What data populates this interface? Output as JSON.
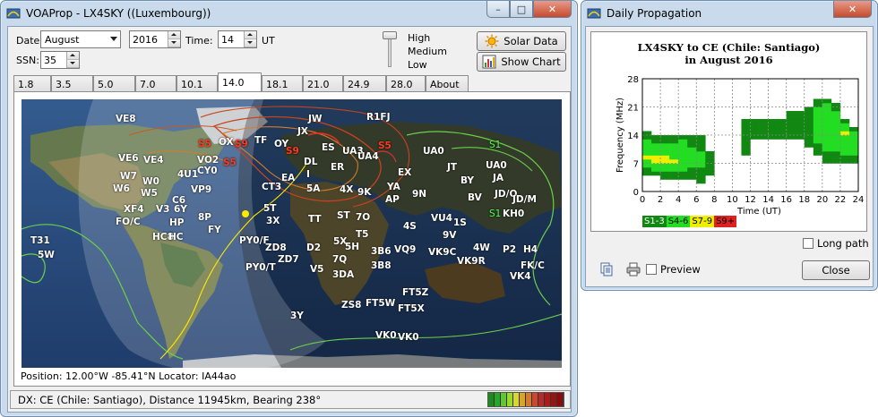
{
  "main_window": {
    "title": "VOAProp - LX4SKY ((Luxembourg))",
    "min_label": "–",
    "max_label": "□",
    "close_label": "✕",
    "date_label": "Date:",
    "month": "August",
    "year": "2016",
    "time_label": "Time:",
    "time": "14",
    "time_unit": "UT",
    "ssn_label": "SSN:",
    "ssn": "35",
    "level_high": "High",
    "level_medium": "Medium",
    "level_low": "Low",
    "solar_data_button": "Solar Data",
    "show_chart_button": "Show Chart",
    "tabs": [
      "1.8",
      "3.5",
      "5.0",
      "7.0",
      "10.1",
      "14.0",
      "18.1",
      "21.0",
      "24.9",
      "28.0",
      "About"
    ],
    "active_tab": "14.0",
    "position_text": "Position: 12.00°W -85.41°N  Locator: IA44ao",
    "status_text": "DX: CE (Chile: Santiago), Distance 11945km, Bearing 238°",
    "meter_colors": [
      "#1d8a1d",
      "#2aa52a",
      "#5cc92c",
      "#9ad82c",
      "#d8d82c",
      "#d8a52c",
      "#d8782c",
      "#c84a2c",
      "#b82a2a",
      "#a81c1c",
      "#981414",
      "#880c0c"
    ],
    "map_labels": [
      {
        "t": "VE8",
        "c": "white"
      },
      {
        "t": "JW",
        "c": "white"
      },
      {
        "t": "R1FJ",
        "c": "white"
      },
      {
        "t": "S5",
        "c": "red"
      },
      {
        "t": "OX",
        "c": "white"
      },
      {
        "t": "S9",
        "c": "red"
      },
      {
        "t": "TF",
        "c": "white"
      },
      {
        "t": "OY",
        "c": "white"
      },
      {
        "t": "JX",
        "c": "white"
      },
      {
        "t": "ES",
        "c": "white"
      },
      {
        "t": "UA3",
        "c": "white"
      },
      {
        "t": "S5",
        "c": "red"
      },
      {
        "t": "UA4",
        "c": "white"
      },
      {
        "t": "UA0",
        "c": "white"
      },
      {
        "t": "S1",
        "c": "green"
      },
      {
        "t": "VE6",
        "c": "white"
      },
      {
        "t": "VE4",
        "c": "white"
      },
      {
        "t": "VO2",
        "c": "white"
      },
      {
        "t": "S5",
        "c": "red"
      },
      {
        "t": "CY0",
        "c": "white"
      },
      {
        "t": "S9",
        "c": "red"
      },
      {
        "t": "DL",
        "c": "white"
      },
      {
        "t": "ER",
        "c": "white"
      },
      {
        "t": "JT",
        "c": "white"
      },
      {
        "t": "UA0",
        "c": "white"
      },
      {
        "t": "W7",
        "c": "white"
      },
      {
        "t": "4U1",
        "c": "white"
      },
      {
        "t": "EA",
        "c": "white"
      },
      {
        "t": "I",
        "c": "white"
      },
      {
        "t": "EX",
        "c": "white"
      },
      {
        "t": "BY",
        "c": "white"
      },
      {
        "t": "JA",
        "c": "white"
      },
      {
        "t": "W0",
        "c": "white"
      },
      {
        "t": "W6",
        "c": "white"
      },
      {
        "t": "W5",
        "c": "white"
      },
      {
        "t": "VP9",
        "c": "white"
      },
      {
        "t": "CT3",
        "c": "white"
      },
      {
        "t": "5A",
        "c": "white"
      },
      {
        "t": "4X",
        "c": "white"
      },
      {
        "t": "9K",
        "c": "white"
      },
      {
        "t": "YA",
        "c": "white"
      },
      {
        "t": "9N",
        "c": "white"
      },
      {
        "t": "BV",
        "c": "white"
      },
      {
        "t": "JD/O",
        "c": "white"
      },
      {
        "t": "JD/M",
        "c": "white"
      },
      {
        "t": "C6",
        "c": "white"
      },
      {
        "t": "XF4",
        "c": "white"
      },
      {
        "t": "V3",
        "c": "white"
      },
      {
        "t": "6Y",
        "c": "white"
      },
      {
        "t": "8P",
        "c": "white"
      },
      {
        "t": "5T",
        "c": "white"
      },
      {
        "t": "AP",
        "c": "white"
      },
      {
        "t": "KH0",
        "c": "white"
      },
      {
        "t": "FO/C",
        "c": "white"
      },
      {
        "t": "HP",
        "c": "white"
      },
      {
        "t": "3X",
        "c": "white"
      },
      {
        "t": "TT",
        "c": "white"
      },
      {
        "t": "ST",
        "c": "white"
      },
      {
        "t": "7O",
        "c": "white"
      },
      {
        "t": "VU4",
        "c": "white"
      },
      {
        "t": "4S",
        "c": "white"
      },
      {
        "t": "1S",
        "c": "white"
      },
      {
        "t": "S1",
        "c": "green"
      },
      {
        "t": "FY",
        "c": "white"
      },
      {
        "t": "T5",
        "c": "white"
      },
      {
        "t": "9V",
        "c": "white"
      },
      {
        "t": "T31",
        "c": "white"
      },
      {
        "t": "HC8",
        "c": "white"
      },
      {
        "t": "HC",
        "c": "white"
      },
      {
        "t": "PY0/F",
        "c": "white"
      },
      {
        "t": "ZD8",
        "c": "white"
      },
      {
        "t": "D2",
        "c": "white"
      },
      {
        "t": "5X",
        "c": "white"
      },
      {
        "t": "5H",
        "c": "white"
      },
      {
        "t": "3B6",
        "c": "white"
      },
      {
        "t": "VQ9",
        "c": "white"
      },
      {
        "t": "4W",
        "c": "white"
      },
      {
        "t": "P2",
        "c": "white"
      },
      {
        "t": "H4",
        "c": "white"
      },
      {
        "t": "5W",
        "c": "white"
      },
      {
        "t": "ZD7",
        "c": "white"
      },
      {
        "t": "7Q",
        "c": "white"
      },
      {
        "t": "VK9C",
        "c": "white"
      },
      {
        "t": "VK9R",
        "c": "white"
      },
      {
        "t": "FK/C",
        "c": "white"
      },
      {
        "t": "PY0/T",
        "c": "white"
      },
      {
        "t": "V5",
        "c": "white"
      },
      {
        "t": "3DA",
        "c": "white"
      },
      {
        "t": "3B8",
        "c": "white"
      },
      {
        "t": "VK4",
        "c": "white"
      },
      {
        "t": "FT5Z",
        "c": "white"
      },
      {
        "t": "ZS8",
        "c": "white"
      },
      {
        "t": "FT5W",
        "c": "white"
      },
      {
        "t": "FT5X",
        "c": "white"
      },
      {
        "t": "3Y",
        "c": "white"
      },
      {
        "t": "VK0",
        "c": "white"
      },
      {
        "t": "VK0",
        "c": "white"
      }
    ]
  },
  "prop_window": {
    "title": "Daily Propagation",
    "close_x_label": "✕",
    "long_path_label": "Long path",
    "preview_label": "Preview",
    "close_button": "Close"
  },
  "chart_data": {
    "type": "heatmap",
    "title_line1": "LX4SKY to CE (Chile: Santiago)",
    "title_line2": "in August 2016",
    "ylabel": "Frequency (MHz)",
    "xlabel": "Time (UT)",
    "x_ticks": [
      0,
      2,
      4,
      6,
      8,
      10,
      12,
      14,
      16,
      18,
      20,
      22,
      24
    ],
    "y_ticks": [
      0,
      7,
      14,
      21,
      28
    ],
    "xlim": [
      0,
      24
    ],
    "ylim": [
      0,
      28
    ],
    "legend": [
      {
        "label": "S1-3",
        "color": "#118811"
      },
      {
        "label": "S4-6",
        "color": "#22dd22"
      },
      {
        "label": "S7-9",
        "color": "#eeee00"
      },
      {
        "label": "S9+",
        "color": "#dd2222"
      }
    ],
    "cells_note_levels": "level 1=S1-3, 2=S4-6, 3=S7-9",
    "cells": [
      {
        "hour": 0,
        "fmin": 4,
        "fmax": 15,
        "level": [
          1,
          1,
          2,
          2,
          3,
          2,
          2,
          2,
          2,
          1,
          1
        ]
      },
      {
        "hour": 1,
        "fmin": 4,
        "fmax": 14,
        "level": [
          1,
          2,
          2,
          3,
          3,
          2,
          2,
          2,
          1,
          1
        ]
      },
      {
        "hour": 2,
        "fmin": 3,
        "fmax": 14,
        "level": [
          1,
          1,
          2,
          2,
          3,
          3,
          2,
          2,
          2,
          1,
          1
        ]
      },
      {
        "hour": 3,
        "fmin": 3,
        "fmax": 14,
        "level": [
          1,
          1,
          2,
          2,
          3,
          2,
          2,
          2,
          2,
          1,
          1
        ]
      },
      {
        "hour": 4,
        "fmin": 3,
        "fmax": 14,
        "level": [
          1,
          1,
          2,
          2,
          2,
          2,
          2,
          2,
          2,
          2,
          1
        ]
      },
      {
        "hour": 5,
        "fmin": 3,
        "fmax": 14,
        "level": [
          1,
          1,
          1,
          2,
          2,
          2,
          2,
          2,
          1,
          1,
          1
        ]
      },
      {
        "hour": 6,
        "fmin": 2,
        "fmax": 14,
        "level": [
          1,
          1,
          1,
          1,
          2,
          2,
          2,
          2,
          1,
          1,
          1,
          1
        ]
      },
      {
        "hour": 7,
        "fmin": 4,
        "fmax": 10,
        "level": [
          1,
          1,
          1,
          1,
          1,
          1
        ]
      },
      {
        "hour": 11,
        "fmin": 9,
        "fmax": 18,
        "level": [
          1,
          1,
          1,
          1,
          1,
          1,
          1,
          1,
          1
        ]
      },
      {
        "hour": 12,
        "fmin": 13,
        "fmax": 18,
        "level": [
          1,
          1,
          1,
          1,
          1
        ]
      },
      {
        "hour": 13,
        "fmin": 13,
        "fmax": 18,
        "level": [
          1,
          1,
          1,
          1,
          1
        ]
      },
      {
        "hour": 14,
        "fmin": 13,
        "fmax": 18,
        "level": [
          1,
          1,
          1,
          1,
          1
        ]
      },
      {
        "hour": 15,
        "fmin": 13,
        "fmax": 18,
        "level": [
          1,
          1,
          1,
          1,
          1
        ]
      },
      {
        "hour": 16,
        "fmin": 13,
        "fmax": 20,
        "level": [
          1,
          1,
          1,
          1,
          1,
          1,
          1
        ]
      },
      {
        "hour": 17,
        "fmin": 13,
        "fmax": 20,
        "level": [
          1,
          1,
          1,
          1,
          1,
          1,
          1
        ]
      },
      {
        "hour": 18,
        "fmin": 11,
        "fmax": 21,
        "level": [
          1,
          1,
          1,
          1,
          1,
          1,
          1,
          1,
          1,
          1
        ]
      },
      {
        "hour": 19,
        "fmin": 9,
        "fmax": 23,
        "level": [
          1,
          1,
          1,
          2,
          2,
          2,
          2,
          2,
          2,
          2,
          2,
          2,
          1,
          1
        ]
      },
      {
        "hour": 20,
        "fmin": 7,
        "fmax": 23,
        "level": [
          1,
          1,
          1,
          2,
          2,
          2,
          2,
          2,
          2,
          2,
          2,
          2,
          2,
          2,
          2,
          1
        ]
      },
      {
        "hour": 21,
        "fmin": 7,
        "fmax": 22,
        "level": [
          1,
          1,
          1,
          2,
          2,
          2,
          2,
          2,
          2,
          2,
          2,
          2,
          2,
          1,
          1
        ]
      },
      {
        "hour": 22,
        "fmin": 7,
        "fmax": 18,
        "level": [
          1,
          1,
          2,
          2,
          2,
          2,
          2,
          3,
          2,
          2,
          1
        ]
      },
      {
        "hour": 23,
        "fmin": 7,
        "fmax": 16,
        "level": [
          1,
          1,
          2,
          2,
          2,
          2,
          2,
          2,
          1
        ]
      }
    ]
  }
}
